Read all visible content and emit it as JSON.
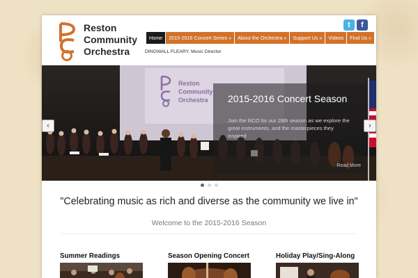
{
  "header": {
    "logo_lines": [
      "Reston",
      "Community",
      "Orchestra"
    ],
    "director": "DINGWALL FLEARY, Music Director",
    "social": [
      {
        "icon": "twitter-icon",
        "glyph": "t",
        "color": "#4ab3e6"
      },
      {
        "icon": "facebook-icon",
        "glyph": "f",
        "color": "#3b5998"
      }
    ]
  },
  "nav": {
    "items": [
      {
        "label": "Home",
        "active": true
      },
      {
        "label": "2015-2016 Concert Series »"
      },
      {
        "label": "About the Orchestra »"
      },
      {
        "label": "Support Us »"
      },
      {
        "label": "Videos"
      },
      {
        "label": "Find Us »"
      }
    ]
  },
  "slider": {
    "screen_logo_lines": [
      "Reston",
      "Community",
      "Orchestra"
    ],
    "title": "2015-2016 Concert Season",
    "description": "Join the RCO for our 28th season as we explore the great instruments, and the masterpieces they inspired",
    "read_more": "Read More",
    "prev": "‹",
    "next": "›",
    "dots": 3,
    "active_dot": 0
  },
  "tagline": "\"Celebrating music as rich and diverse as the community we live in\"",
  "welcome": "Welcome to the 2015-2016 Season",
  "features": [
    {
      "title": "Summer Readings"
    },
    {
      "title": "Season Opening Concert"
    },
    {
      "title": "Holiday Play/Sing-Along"
    }
  ],
  "colors": {
    "accent": "#d2722a",
    "nav_active": "#1b1b1b",
    "background": "#efe1c4"
  }
}
